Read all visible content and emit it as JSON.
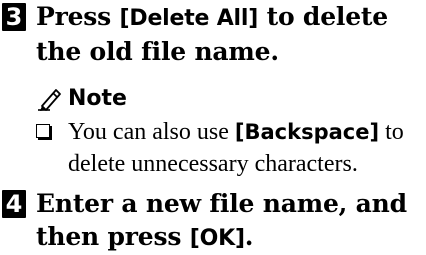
{
  "step3": {
    "number": "3",
    "text_before": "Press ",
    "key": "[Delete All]",
    "text_after": " to delete the old file name."
  },
  "note": {
    "title": "Note",
    "icon": "pencil-icon",
    "item": {
      "text_before": "You can also use ",
      "key": "[Backspace]",
      "text_after": " to delete unnecessary characters."
    }
  },
  "step4": {
    "number": "4",
    "text_before": "Enter a new file name, and then press ",
    "key": "[OK]",
    "text_after": "."
  }
}
